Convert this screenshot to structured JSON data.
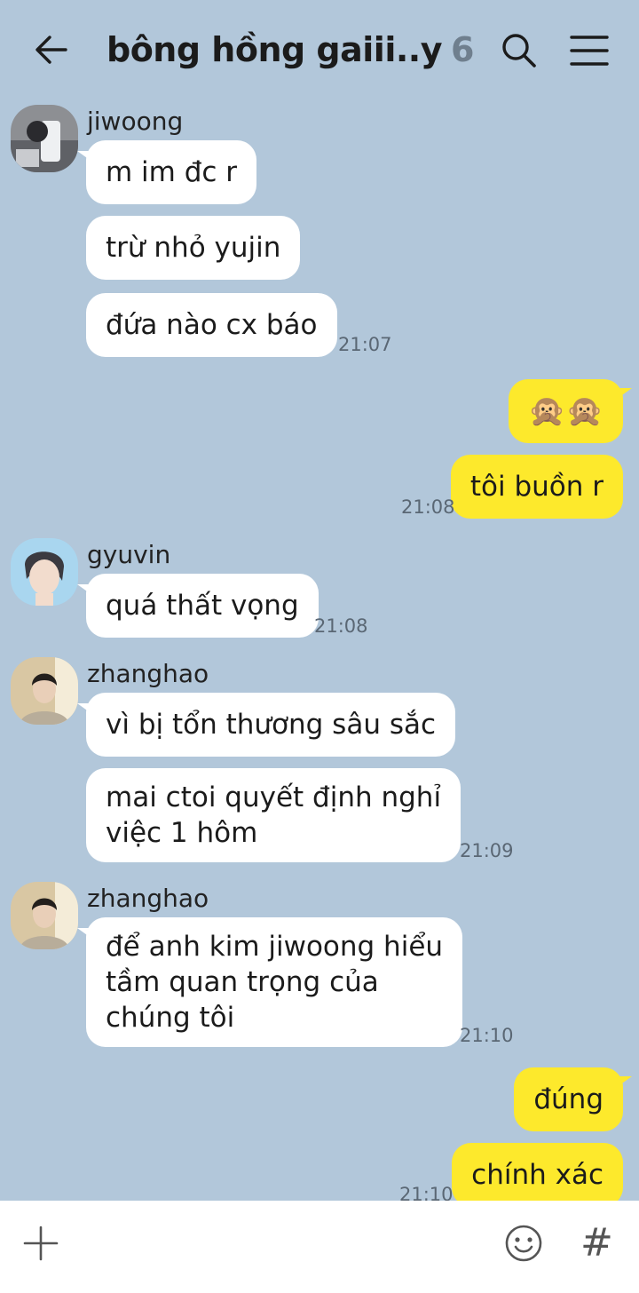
{
  "header": {
    "title": "bông hồng gaiii..y",
    "member_count": "6",
    "icons": [
      "back-arrow-icon",
      "search-icon",
      "menu-icon"
    ]
  },
  "colors": {
    "background": "#b2c7da",
    "incoming_bubble": "#ffffff",
    "outgoing_bubble": "#fde92c",
    "timestamp": "#5a6774"
  },
  "messages": {
    "g1": {
      "sender": "jiwoong",
      "bubbles": [
        "m im đc r",
        "trừ nhỏ yujin",
        "đứa nào cx báo"
      ],
      "time": "21:07"
    },
    "me1": {
      "bubbles": [
        "🙊🙊",
        "tôi buồn r"
      ],
      "time": "21:08"
    },
    "g2": {
      "sender": "gyuvin",
      "bubbles": [
        "quá thất vọng"
      ],
      "time": "21:08"
    },
    "g3": {
      "sender": "zhanghao",
      "bubbles": [
        "vì bị tổn thương sâu sắc",
        "mai ctoi quyết định nghỉ\nviệc 1 hôm"
      ],
      "time": "21:09"
    },
    "g4": {
      "sender": "zhanghao",
      "bubbles": [
        "để anh kim jiwoong hiểu\ntầm quan trọng của\nchúng tôi"
      ],
      "time": "21:10"
    },
    "me2": {
      "bubbles": [
        "đúng",
        "chính xác"
      ],
      "time": "21:10"
    }
  },
  "footer": {
    "icons": [
      "plus-icon",
      "emoji-icon",
      "hashtag-icon"
    ],
    "hashtag_label": "#"
  }
}
